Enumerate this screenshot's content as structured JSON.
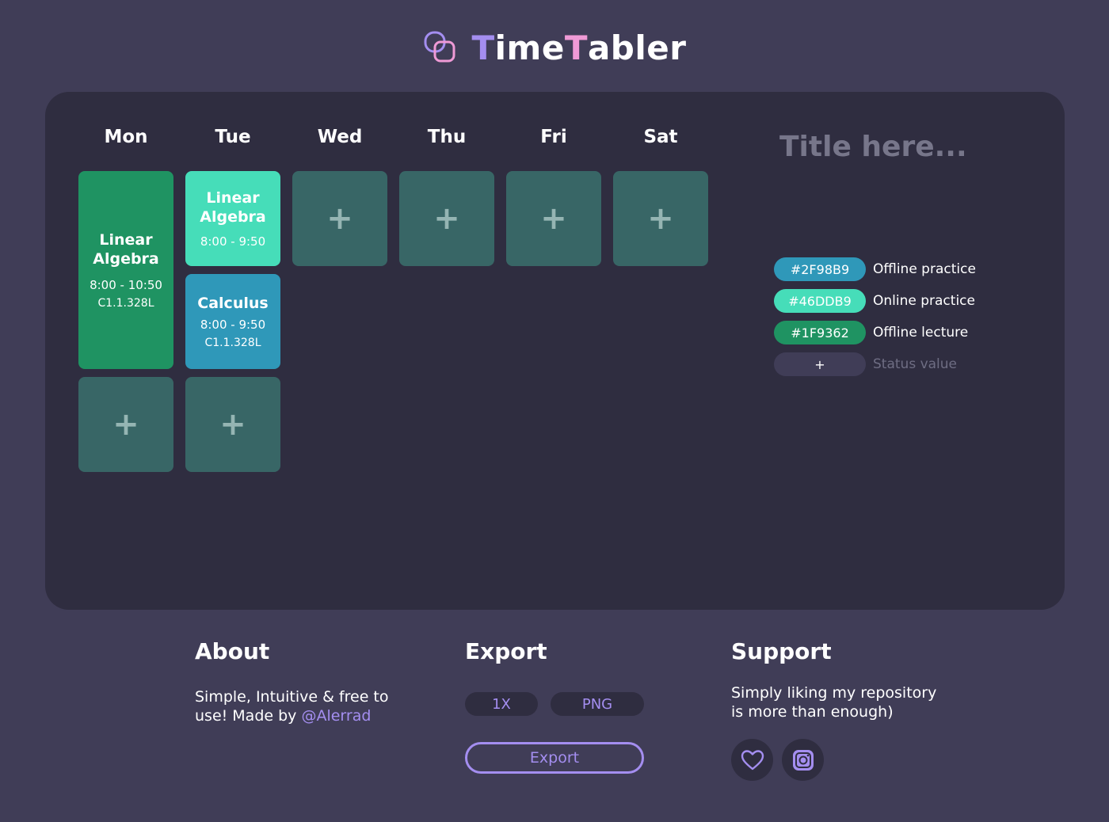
{
  "brand": {
    "first": "T",
    "mid": "ime",
    "second": "T",
    "rest": "abler"
  },
  "days": [
    "Mon",
    "Tue",
    "Wed",
    "Thu",
    "Fri",
    "Sat"
  ],
  "add_symbol": "+",
  "classes": {
    "mon_1": {
      "subject_l1": "Linear",
      "subject_l2": "Algebra",
      "time": "8:00 - 10:50",
      "room": "C1.1.328L",
      "color": "#1F9362"
    },
    "tue_1": {
      "subject_l1": "Linear",
      "subject_l2": "Algebra",
      "time": "8:00 - 9:50",
      "color": "#46DDB9"
    },
    "tue_2": {
      "subject": "Calculus",
      "time": "8:00 - 9:50",
      "room": "C1.1.328L",
      "color": "#2F98B9"
    }
  },
  "title_input": {
    "placeholder": "Title here..."
  },
  "legend": [
    {
      "hex": "#2F98B9",
      "label": "Offline practice",
      "color": "#2F98B9"
    },
    {
      "hex": "#46DDB9",
      "label": "Online practice",
      "color": "#46DDB9"
    },
    {
      "hex": "#1F9362",
      "label": "Offline lecture",
      "color": "#1F9362"
    }
  ],
  "legend_add": {
    "symbol": "+",
    "placeholder": "Status value"
  },
  "footer": {
    "about": {
      "heading": "About",
      "text_l1": "Simple, Intuitive & free to",
      "text_l2": "use! Made by ",
      "link": "@Alerrad"
    },
    "export": {
      "heading": "Export",
      "scale": "1X",
      "format": "PNG",
      "button": "Export"
    },
    "support": {
      "heading": "Support",
      "text_l1": "Simply liking my repository",
      "text_l2": "is more than enough)"
    }
  },
  "icons": {
    "logo": "overlapping-squares-icon",
    "like": "heart-icon",
    "instagram": "instagram-icon"
  },
  "colors": {
    "accent": "#A48EF0",
    "pink": "#EF9AD6",
    "empty_tile": "#386666"
  }
}
